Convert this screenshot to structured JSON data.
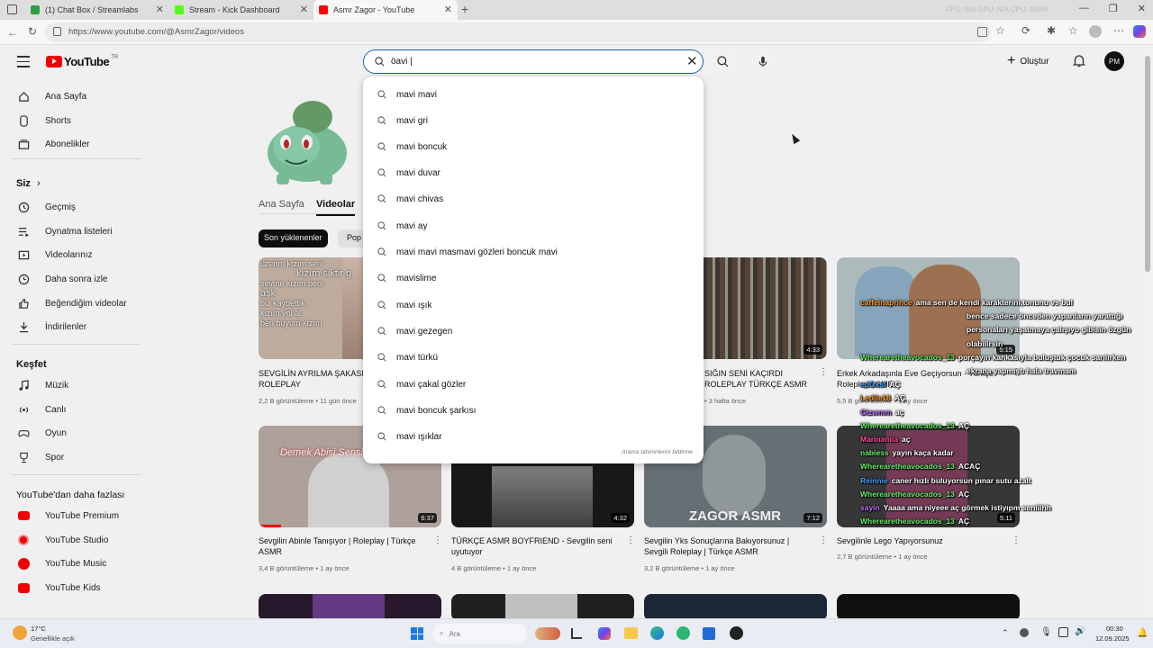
{
  "browser": {
    "tabs": [
      {
        "label": "(1) Chat Box / Streamlabs",
        "color": "#2ea043"
      },
      {
        "label": "Stream - Kick Dashboard",
        "color": "#53fc18"
      },
      {
        "label": "Asmr Zagor - YouTube",
        "color": "#ff0000"
      }
    ],
    "url": "https://www.youtube.com/@AsmrZagor/videos",
    "stats_overlay": "FPS: N/A   GPU: N/A   CPU: 100%"
  },
  "youtube": {
    "logo": "YouTube",
    "country": "TR",
    "search_value": "öavi |",
    "create_label": "Oluştur",
    "avatar": "PM",
    "suggestions": [
      "mavi mavi",
      "mavi gri",
      "mavi boncuk",
      "mavi duvar",
      "mavi chivas",
      "mavi ay",
      "mavi mavi masmavi gözleri boncuk mavi",
      "mavislime",
      "mavi ışık",
      "mavi gezegen",
      "mavi türkü",
      "mavi çakal gözler",
      "mavi boncuk şarkısı",
      "mavi ışıklar"
    ],
    "report": "Arama tahminlerini bildirme"
  },
  "sidebar": {
    "main": [
      {
        "label": "Ana Sayfa",
        "icon": "home-icon"
      },
      {
        "label": "Shorts",
        "icon": "shorts-icon"
      },
      {
        "label": "Abonelikler",
        "icon": "subscriptions-icon"
      }
    ],
    "you_title": "Siz",
    "you": [
      {
        "label": "Geçmiş",
        "icon": "history-icon"
      },
      {
        "label": "Oynatma listeleri",
        "icon": "playlist-icon"
      },
      {
        "label": "Videolarınız",
        "icon": "your-videos-icon"
      },
      {
        "label": "Daha sonra izle",
        "icon": "watch-later-icon"
      },
      {
        "label": "Beğendiğim videolar",
        "icon": "like-icon"
      },
      {
        "label": "İndirilenler",
        "icon": "download-icon"
      }
    ],
    "explore_title": "Keşfet",
    "explore": [
      {
        "label": "Müzik",
        "icon": "music-icon"
      },
      {
        "label": "Canlı",
        "icon": "live-icon"
      },
      {
        "label": "Oyun",
        "icon": "gaming-icon"
      },
      {
        "label": "Spor",
        "icon": "sports-icon"
      }
    ],
    "more_title": "YouTube'dan daha fazlası",
    "more": [
      {
        "label": "YouTube Premium",
        "icon": "yt-premium-icon"
      },
      {
        "label": "YouTube Studio",
        "icon": "yt-studio-icon"
      },
      {
        "label": "YouTube Music",
        "icon": "yt-music-icon"
      },
      {
        "label": "YouTube Kids",
        "icon": "yt-kids-icon"
      }
    ]
  },
  "channel": {
    "tabs": [
      "Ana Sayfa",
      "Videolar"
    ],
    "chips": [
      "Son yüklenenler",
      "Pop"
    ]
  },
  "videos_row1": [
    {
      "title": "SEVGİLİN AYRILMA ŞAKASI",
      "title2": "ROLEPLAY",
      "meta": "2,2 B görüntüleme • 11 gün önce",
      "duration": "",
      "bg": "#c9b6a8",
      "overlay_lines": [
        "üzerim kızım seni",
        "kızım siktir g",
        "sevme kızım beni",
        "aşk",
        "biz kaybettik",
        "kızım yol al",
        "ben buyum kızım"
      ]
    },
    {
      "title": "SIĞIN SENİ KAÇIRDI",
      "title2": "ROLEPLAY  TÜRKÇE ASMR",
      "meta": "• 3 hafta önce",
      "duration": "4:33",
      "bg": "#8e8a86",
      "overlay_lines": []
    },
    {
      "title": "Erkek Arkadaşınla Eve Geçiyorsun - Türkçe",
      "title2": "Roleplay ASMR",
      "meta": "5,5 B görüntüleme • 1 ay önce",
      "duration": "5:15",
      "bg": "#b7c6c8",
      "overlay_lines": []
    }
  ],
  "videos_row2": [
    {
      "title": "Sevgilin Abinle Tanışıyor | Roleplay | Türkçe",
      "title2": "ASMR",
      "meta": "3,4 B görüntüleme • 1 ay önce",
      "duration": "6:37",
      "bg": "#b9aaa4",
      "caption": "Demek Abisi Sensin"
    },
    {
      "title": "TÜRKÇE ASMR BOYFRIEND - Sevgilin seni",
      "title2": "uyutuyor",
      "meta": "4 B görüntüleme • 1 ay önce",
      "duration": "4:32",
      "bg": "#4a4a4a",
      "caption": ""
    },
    {
      "title": "Sevgilin Yks Sonuçlarına Bakıyorsunuz |",
      "title2": "Sevgili Roleplay | Türkçe ASMR",
      "meta": "3,2 B görüntüleme • 1 ay önce",
      "duration": "7:12",
      "bg": "#6d767c",
      "caption": "ZAGOR ASMR"
    },
    {
      "title": "Sevgilinle Lego Yapıyorsunuz",
      "title2": "",
      "meta": "2,7 B görüntüleme • 1 ay önce",
      "duration": "5:11",
      "bg": "#3b3b3b",
      "caption": ""
    }
  ],
  "chat": [
    {
      "user": "caffeinaprince",
      "color": "#ff9d2e",
      "msg": "ama sen de kendi karakterini,tonunu vs bul"
    },
    {
      "user": "",
      "color": "#ffffff",
      "msg": "bence sadece önceden yapanların yarattığı"
    },
    {
      "user": "",
      "color": "#ffffff",
      "msg": "personaları yaşatmaya çalışıyo gibisin özgün"
    },
    {
      "user": "",
      "color": "#ffffff",
      "msg": "olabilirsin"
    },
    {
      "user": "Wherearetheavocados_13",
      "color": "#6bf06b",
      "msg": "porçayın kankasıyla buluştuk çocuk sarılırken"
    },
    {
      "user": "",
      "color": "#ffffff",
      "msg": "ekrana yapmıştı hala travmam"
    },
    {
      "user": "edOxsl",
      "color": "#4aa0ff",
      "msg": "AÇ"
    },
    {
      "user": "Ledile18",
      "color": "#ff9d2e",
      "msg": "AÇ"
    },
    {
      "user": "Gizwmm",
      "color": "#c070ff",
      "msg": "aç"
    },
    {
      "user": "Wherearetheavocados_13",
      "color": "#6bf06b",
      "msg": "AÇ"
    },
    {
      "user": "Marinamia",
      "color": "#ff4fa0",
      "msg": "aç"
    },
    {
      "user": "nabiess",
      "color": "#6bf06b",
      "msg": "yayın kaça kadar"
    },
    {
      "user": "Wherearetheavocados_13",
      "color": "#6bf06b",
      "msg": "ACAÇ"
    },
    {
      "user": "Reinnie",
      "color": "#4aa0ff",
      "msg": "caner hızlı buluyorsun pınar sutu azalt"
    },
    {
      "user": "Wherearetheavocados_13",
      "color": "#6bf06b",
      "msg": "AÇ"
    },
    {
      "user": "sayin",
      "color": "#c070ff",
      "msg": "Yaaaa ama niyeee aç görmek istiyıpm seniiihh"
    },
    {
      "user": "Wherearetheavocados_13",
      "color": "#6bf06b",
      "msg": "AÇ"
    }
  ],
  "taskbar": {
    "weather_temp": "17°C",
    "weather_desc": "Genellikle açık",
    "search": "Ara",
    "time": "00:30",
    "date": "12.09.2025"
  }
}
